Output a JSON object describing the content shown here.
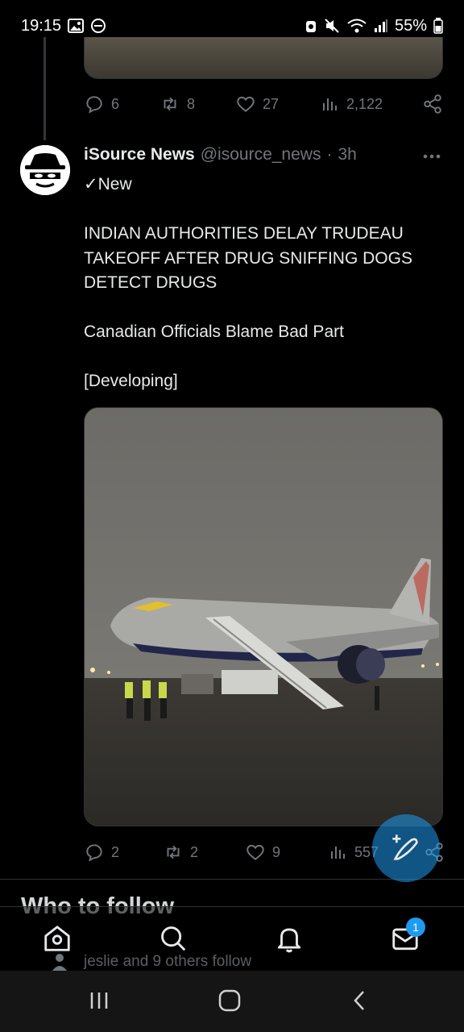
{
  "status_bar": {
    "time": "19:15",
    "battery": "55%"
  },
  "prev_tweet": {
    "replies": "6",
    "retweets": "8",
    "likes": "27",
    "views": "2,122"
  },
  "tweet": {
    "name": "iSource News",
    "handle": "@isource_news",
    "dot": "·",
    "time": "3h",
    "lines": [
      "✓New",
      "",
      "INDIAN AUTHORITIES DELAY TRUDEAU",
      "TAKEOFF AFTER DRUG SNIFFING DOGS",
      "DETECT DRUGS",
      "",
      "Canadian Officials Blame Bad Part",
      "",
      "[Developing]"
    ],
    "replies": "2",
    "retweets": "2",
    "likes": "9",
    "views": "557"
  },
  "who_to_follow": {
    "title": "Who to follow",
    "note": "jeslie and 9 others follow"
  },
  "nav": {
    "messages_badge": "1"
  },
  "colors": {
    "accent": "#1d9bf0",
    "muted": "#71767b",
    "text": "#e7e9ea"
  },
  "icons": [
    "gallery-icon",
    "do-not-disturb-icon",
    "alarm-icon",
    "mute-icon",
    "wifi-icon",
    "signal-icon",
    "battery-icon",
    "reply-icon",
    "retweet-icon",
    "like-icon",
    "views-icon",
    "share-icon",
    "more-icon",
    "compose-icon",
    "home-icon",
    "search-icon",
    "notifications-icon",
    "messages-icon",
    "recent-apps-icon",
    "home-button-icon",
    "back-icon"
  ]
}
